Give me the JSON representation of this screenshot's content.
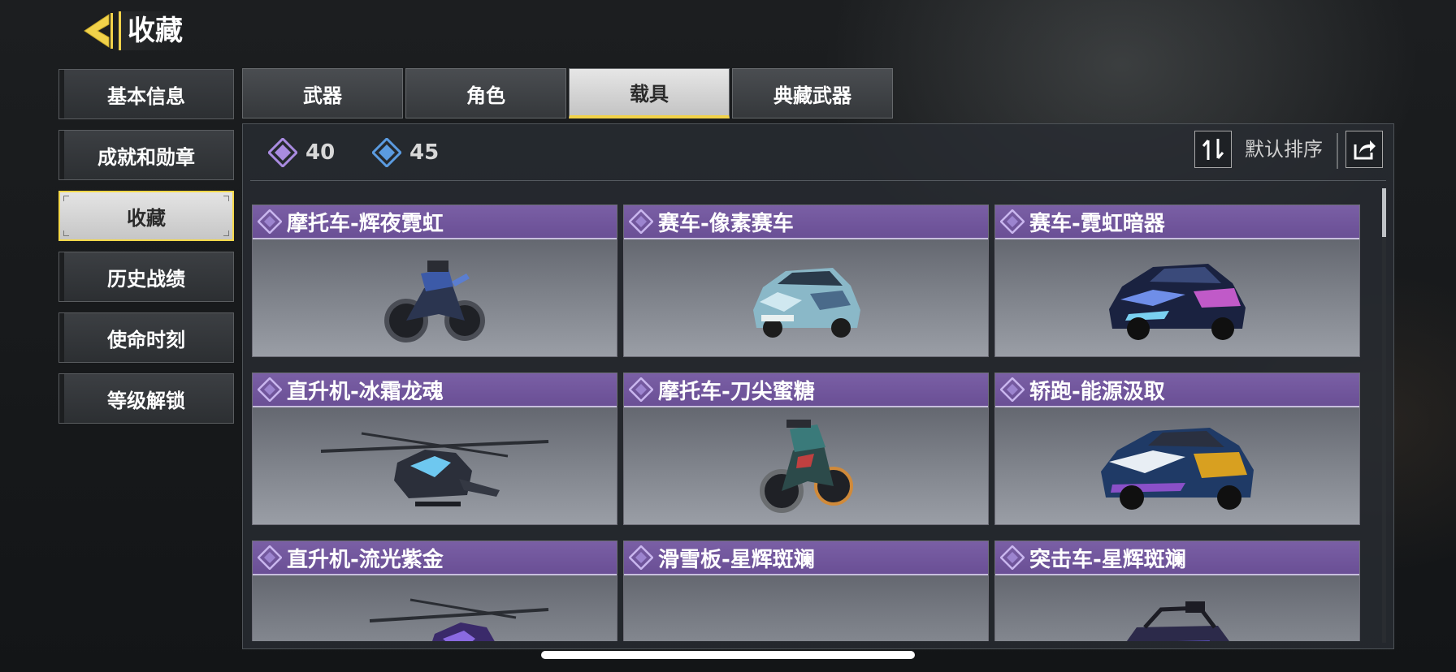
{
  "header": {
    "title": "收藏"
  },
  "sidebar": {
    "items": [
      {
        "label": "基本信息",
        "active": false
      },
      {
        "label": "成就和勋章",
        "active": false
      },
      {
        "label": "收藏",
        "active": true
      },
      {
        "label": "历史战绩",
        "active": false
      },
      {
        "label": "使命时刻",
        "active": false
      },
      {
        "label": "等级解锁",
        "active": false
      }
    ]
  },
  "tabs": [
    {
      "label": "武器",
      "active": false
    },
    {
      "label": "角色",
      "active": false
    },
    {
      "label": "载具",
      "active": true
    },
    {
      "label": "典藏武器",
      "active": false
    }
  ],
  "stats": [
    {
      "icon": "purple-diamond-icon",
      "value": "40",
      "color": "#a98be0"
    },
    {
      "icon": "blue-diamond-icon",
      "value": "45",
      "color": "#5b9be0"
    }
  ],
  "sort": {
    "label": "默认排序",
    "icon": "sort-toggle-icon",
    "share_icon": "share-icon"
  },
  "colors": {
    "accent": "#f1d24a",
    "rarity_purple": "#6a4f95"
  },
  "items": [
    {
      "title": "摩托车-辉夜霓虹",
      "kind": "motorcycle",
      "icon": "motorcycle-icon"
    },
    {
      "title": "赛车-像素赛车",
      "kind": "car",
      "icon": "race-car-icon"
    },
    {
      "title": "赛车-霓虹暗器",
      "kind": "car",
      "icon": "race-car-icon"
    },
    {
      "title": "直升机-冰霜龙魂",
      "kind": "helicopter",
      "icon": "helicopter-icon"
    },
    {
      "title": "摩托车-刀尖蜜糖",
      "kind": "motorcycle",
      "icon": "motorcycle-icon"
    },
    {
      "title": "轿跑-能源汲取",
      "kind": "car",
      "icon": "coupe-icon"
    },
    {
      "title": "直升机-流光紫金",
      "kind": "helicopter",
      "icon": "helicopter-icon"
    },
    {
      "title": "滑雪板-星辉斑斓",
      "kind": "snowboard",
      "icon": "snowmobile-icon"
    },
    {
      "title": "突击车-星辉斑斓",
      "kind": "buggy",
      "icon": "assault-buggy-icon"
    }
  ]
}
